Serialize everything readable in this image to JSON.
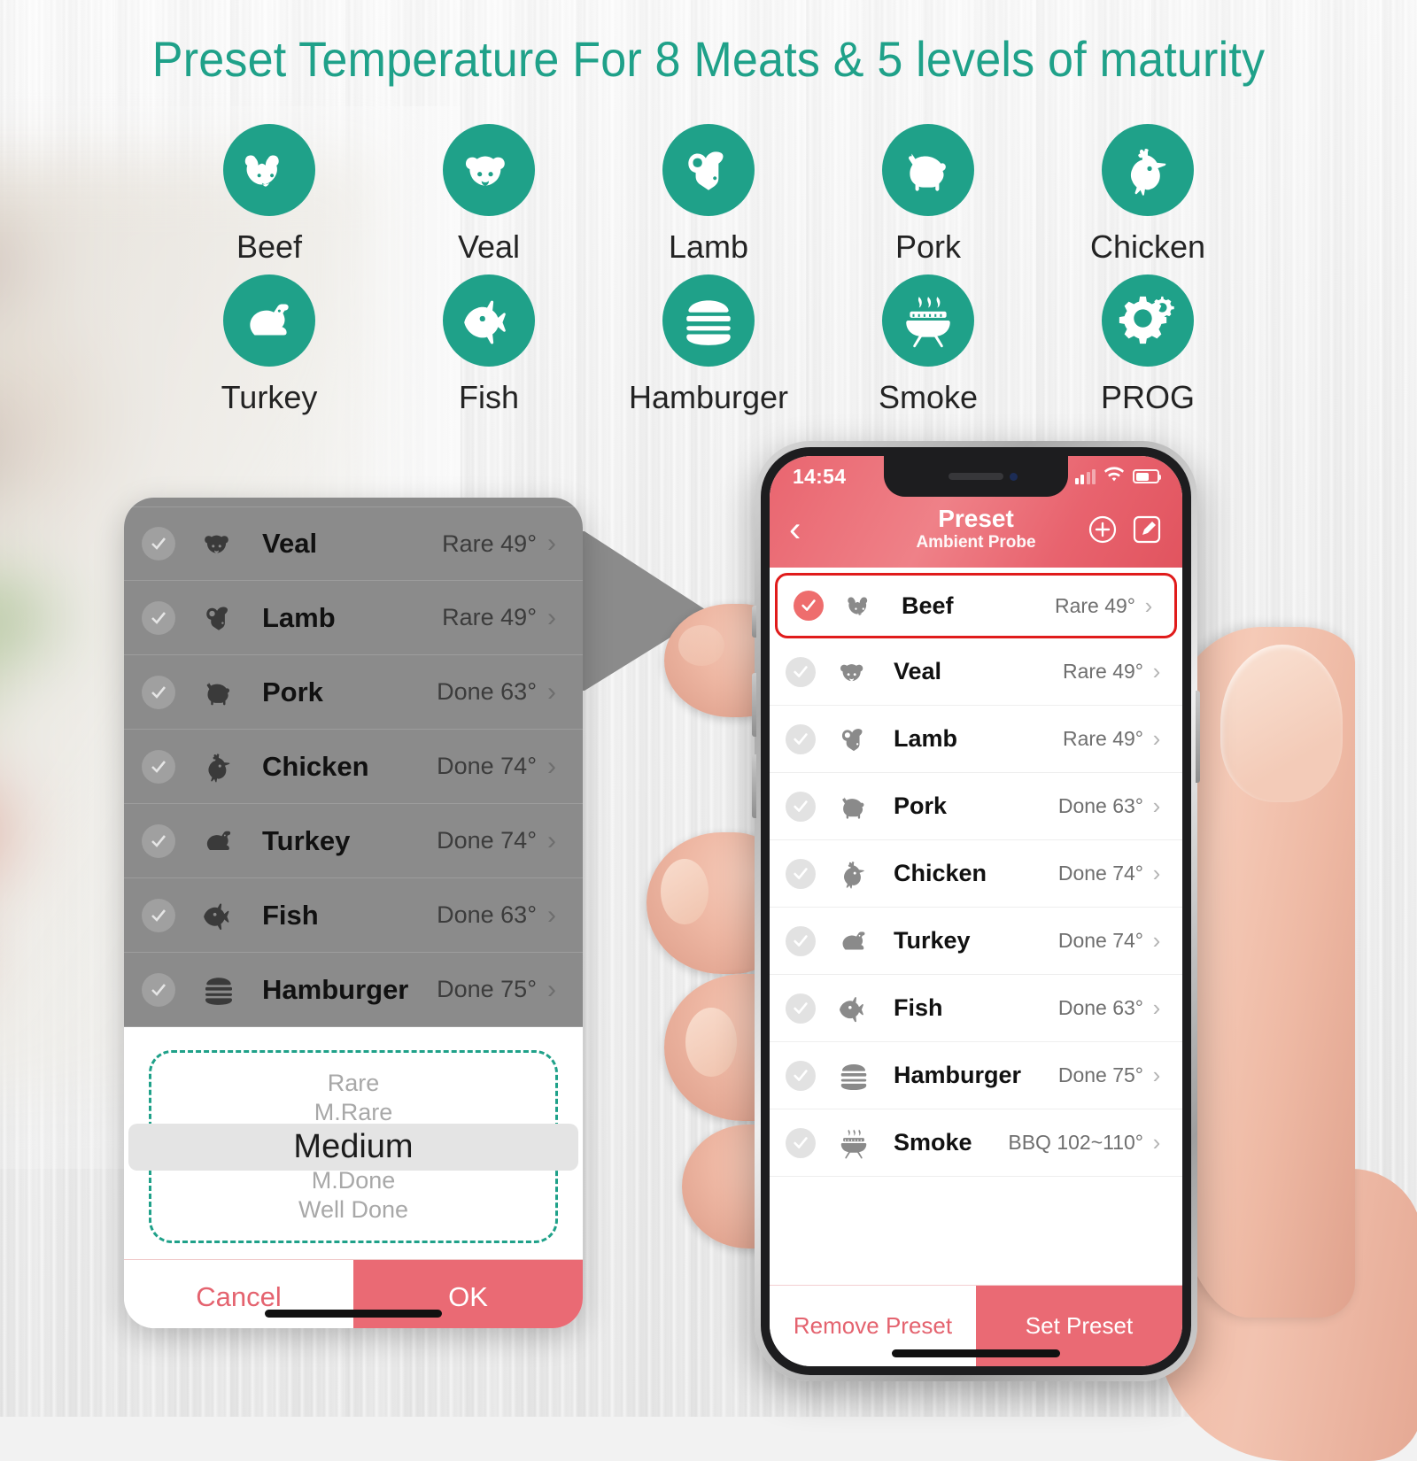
{
  "headline": "Preset Temperature For 8 Meats & 5 levels of maturity",
  "colors": {
    "teal": "#1fa189",
    "red": "#ea6a74",
    "selected_border": "#e01b1b",
    "dim_panel": "#8b8b8b"
  },
  "icon_grid": [
    {
      "label": "Beef",
      "icon": "bull-head-icon"
    },
    {
      "label": "Veal",
      "icon": "calf-head-icon"
    },
    {
      "label": "Lamb",
      "icon": "ram-head-icon"
    },
    {
      "label": "Pork",
      "icon": "pig-icon"
    },
    {
      "label": "Chicken",
      "icon": "rooster-icon"
    },
    {
      "label": "Turkey",
      "icon": "turkey-icon"
    },
    {
      "label": "Fish",
      "icon": "fish-icon"
    },
    {
      "label": "Hamburger",
      "icon": "hamburger-icon"
    },
    {
      "label": "Smoke",
      "icon": "bbq-grill-icon"
    },
    {
      "label": "PROG",
      "icon": "gear-icon"
    }
  ],
  "callout": {
    "rows": [
      {
        "name": "Veal",
        "temp": "Rare 49°",
        "icon": "calf-head-icon",
        "checked": false
      },
      {
        "name": "Lamb",
        "temp": "Rare 49°",
        "icon": "ram-head-icon",
        "checked": false
      },
      {
        "name": "Pork",
        "temp": "Done 63°",
        "icon": "pig-icon",
        "checked": false
      },
      {
        "name": "Chicken",
        "temp": "Done 74°",
        "icon": "rooster-icon",
        "checked": false
      },
      {
        "name": "Turkey",
        "temp": "Done 74°",
        "icon": "turkey-icon",
        "checked": false
      },
      {
        "name": "Fish",
        "temp": "Done 63°",
        "icon": "fish-icon",
        "checked": false
      },
      {
        "name": "Hamburger",
        "temp": "Done 75°",
        "icon": "hamburger-icon",
        "checked": false
      }
    ],
    "picker": {
      "options": [
        "Rare",
        "M.Rare",
        "Medium",
        "M.Done",
        "Well Done"
      ],
      "selected": "Medium",
      "selected_index": 2
    },
    "cancel_label": "Cancel",
    "ok_label": "OK"
  },
  "phone": {
    "status": {
      "time": "14:54",
      "signal_icon": "cellular-signal-icon",
      "wifi_icon": "wifi-icon",
      "battery_icon": "battery-icon"
    },
    "nav": {
      "back_icon": "chevron-left-icon",
      "title": "Preset",
      "subtitle": "Ambient Probe",
      "add_icon": "plus-circle-icon",
      "edit_icon": "edit-pencil-icon"
    },
    "list": [
      {
        "name": "Beef",
        "temp": "Rare 49°",
        "icon": "bull-head-icon",
        "checked": true
      },
      {
        "name": "Veal",
        "temp": "Rare 49°",
        "icon": "calf-head-icon",
        "checked": false
      },
      {
        "name": "Lamb",
        "temp": "Rare 49°",
        "icon": "ram-head-icon",
        "checked": false
      },
      {
        "name": "Pork",
        "temp": "Done 63°",
        "icon": "pig-icon",
        "checked": false
      },
      {
        "name": "Chicken",
        "temp": "Done 74°",
        "icon": "rooster-icon",
        "checked": false
      },
      {
        "name": "Turkey",
        "temp": "Done 74°",
        "icon": "turkey-icon",
        "checked": false
      },
      {
        "name": "Fish",
        "temp": "Done 63°",
        "icon": "fish-icon",
        "checked": false
      },
      {
        "name": "Hamburger",
        "temp": "Done 75°",
        "icon": "hamburger-icon",
        "checked": false
      },
      {
        "name": "Smoke",
        "temp": "BBQ 102~110°",
        "icon": "bbq-grill-icon",
        "checked": false
      }
    ],
    "bottom": {
      "remove_label": "Remove Preset",
      "set_label": "Set Preset"
    }
  }
}
